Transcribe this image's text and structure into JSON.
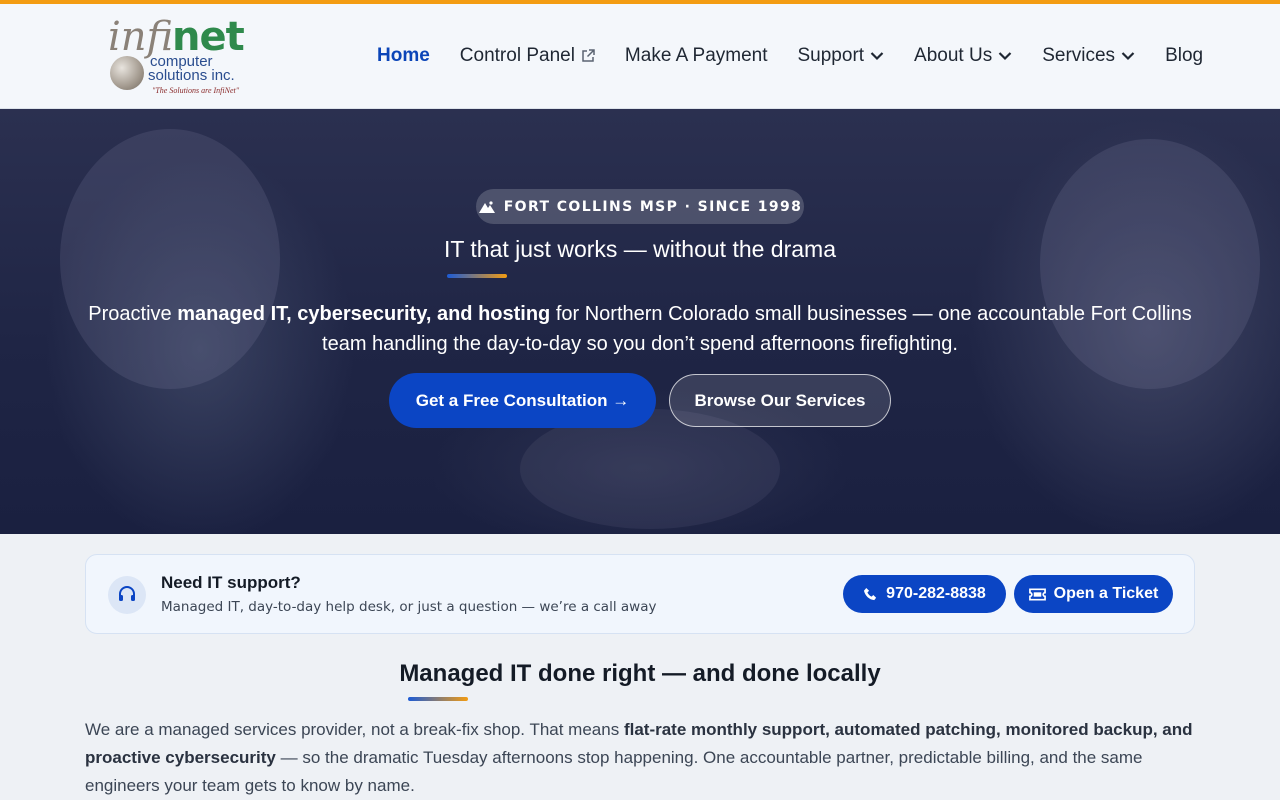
{
  "brand": {
    "logo_infi": "infi",
    "logo_net": "net",
    "logo_line1": "computer",
    "logo_line2": "solutions inc.",
    "logo_tagline": "\"The Solutions are InfiNet\""
  },
  "nav": {
    "items": [
      {
        "label": "Home",
        "active": true,
        "icon": ""
      },
      {
        "label": "Control Panel",
        "active": false,
        "icon": "external-link-icon"
      },
      {
        "label": "Make A Payment",
        "active": false,
        "icon": ""
      },
      {
        "label": "Support",
        "active": false,
        "icon": "chevron-down-icon"
      },
      {
        "label": "About Us",
        "active": false,
        "icon": "chevron-down-icon"
      },
      {
        "label": "Services",
        "active": false,
        "icon": "chevron-down-icon"
      },
      {
        "label": "Blog",
        "active": false,
        "icon": ""
      }
    ]
  },
  "hero": {
    "badge": "FORT COLLINS MSP · SINCE 1998",
    "badge_icon": "mountain-icon",
    "subtitle": "IT that just works — without the drama",
    "desc_pre": "Proactive ",
    "desc_bold": "managed IT, cybersecurity, and hosting",
    "desc_post": " for Northern Colorado small businesses — one accountable Fort Collins team handling the day-to-day so you don’t spend afternoons firefighting.",
    "primary_cta": "Get a Free Consultation →",
    "secondary_cta": "Browse Our Services"
  },
  "support": {
    "icon": "headset-icon",
    "title": "Need IT support?",
    "description": "Managed IT, day-to-day help desk, or just a question — we’re a call away",
    "phone": "970-282-8838",
    "phone_icon": "phone-icon",
    "ticket": "Open a Ticket",
    "ticket_icon": "ticket-icon"
  },
  "section": {
    "title": "Managed IT done right — and done locally",
    "body_pre": "We are a managed services provider, not a break-fix shop. That means ",
    "body_bold": "flat-rate monthly support, automated patching, monitored backup, and proactive cybersecurity",
    "body_post": " — so the dramatic Tuesday afternoons stop happening. One accountable partner, predictable billing, and the same engineers your team gets to know by name."
  },
  "colors": {
    "accent_orange": "#f39c12",
    "primary_blue": "#0b45c4",
    "active_nav": "#0b45b8",
    "hero_dark": "#1f2545"
  }
}
